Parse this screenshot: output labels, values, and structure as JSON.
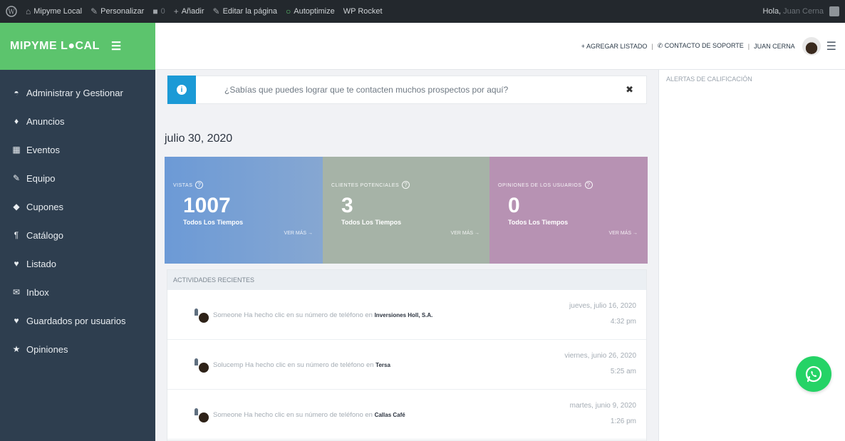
{
  "adminbar": {
    "site_name": "Mipyme Local",
    "customize": "Personalizar",
    "comments_count": "0",
    "add": "Añadir",
    "edit_page": "Editar la página",
    "autoptimize": "Autoptimize",
    "wp_rocket": "WP Rocket",
    "greeting": "Hola,",
    "greeting_name": "Juan Cerna"
  },
  "sidebar": {
    "brand": "MIPYME L●CAL",
    "items": [
      {
        "label": "Administrar y Gestionar",
        "icon": "dashboard-icon"
      },
      {
        "label": "Anuncios",
        "icon": "rocket-icon"
      },
      {
        "label": "Eventos",
        "icon": "calendar-icon"
      },
      {
        "label": "Equipo",
        "icon": "edit-icon"
      },
      {
        "label": "Cupones",
        "icon": "tag-icon"
      },
      {
        "label": "Catálogo",
        "icon": "utensils-icon"
      },
      {
        "label": "Listado",
        "icon": "map-marker-icon"
      },
      {
        "label": "Inbox",
        "icon": "envelope-icon"
      },
      {
        "label": "Guardados por usuarios",
        "icon": "heart-icon"
      },
      {
        "label": "Opiniones",
        "icon": "star-icon"
      }
    ]
  },
  "topbar": {
    "add_listing": "+ AGREGAR LISTADO",
    "support_contact": "CONTACTO DE SOPORTE",
    "user_name": "JUAN CERNA"
  },
  "rightpanel": {
    "title": "ALERTAS DE CALIFICACIÓN"
  },
  "notice": {
    "text": "¿Sabías que puedes lograr que te contacten muchos prospectos por aquí?"
  },
  "date_heading": "julio 30, 2020",
  "stats": [
    {
      "label": "VISTAS",
      "value": "1007",
      "sub": "Todos Los Tiempos",
      "more": "VER MÁS →"
    },
    {
      "label": "CLIENTES POTENCIALES",
      "value": "3",
      "sub": "Todos Los Tiempos",
      "more": "VER MÁS →"
    },
    {
      "label": "OPINIONES DE LOS USUARIOS",
      "value": "0",
      "sub": "Todos Los Tiempos",
      "more": "VER MÁS →"
    }
  ],
  "activities": {
    "header": "ACTIVIDADES RECIENTES",
    "rows": [
      {
        "actor": "Someone",
        "action": "Ha hecho clic en su número de teléfono en",
        "target": "Inversiones Holl, S.A.",
        "date": "jueves, julio 16, 2020",
        "time": "4:32 pm"
      },
      {
        "actor": "Solucemp",
        "action": "Ha hecho clic en su número de teléfono en",
        "target": "Tersa",
        "date": "viernes, junio 26, 2020",
        "time": "5:25 am"
      },
      {
        "actor": "Someone",
        "action": "Ha hecho clic en su número de teléfono en",
        "target": "Callas Café",
        "date": "martes, junio 9, 2020",
        "time": "1:26 pm"
      }
    ]
  },
  "colors": {
    "sidebar_bg": "#2e3e4f",
    "brand_green": "#5cc46d",
    "info_blue": "#1b9ad6",
    "whatsapp_green": "#25d366"
  }
}
